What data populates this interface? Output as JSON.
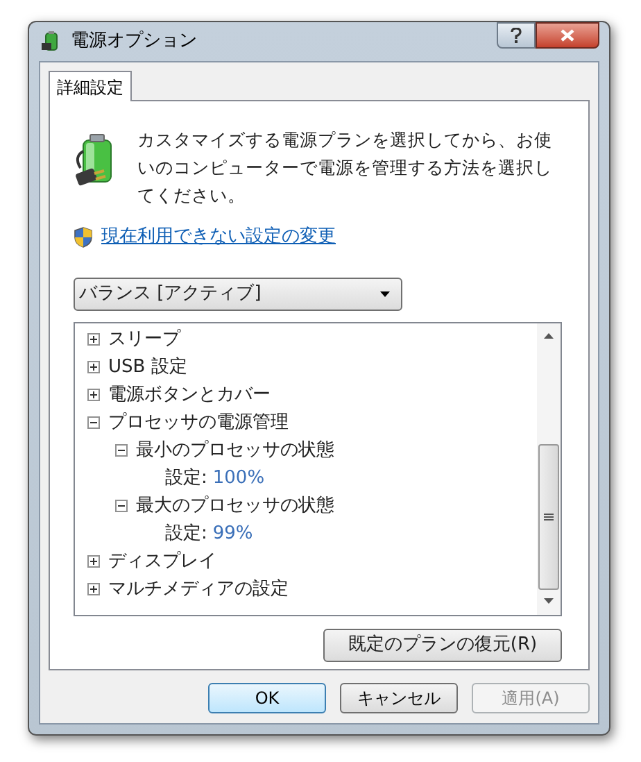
{
  "window": {
    "title": "電源オプション"
  },
  "tabs": [
    {
      "label": "詳細設定",
      "selected": true
    }
  ],
  "description": "カスタマイズする電源プランを選択してから、お使いのコンピューターで電源を管理する方法を選択してください。",
  "change_settings_link": "現在利用できない設定の変更",
  "plan_dropdown": {
    "value": "バランス [アクティブ]"
  },
  "tree": [
    {
      "kind": "group",
      "label": "スリープ",
      "expanded": false
    },
    {
      "kind": "group",
      "label": "USB 設定",
      "expanded": false
    },
    {
      "kind": "group",
      "label": "電源ボタンとカバー",
      "expanded": false
    },
    {
      "kind": "group",
      "label": "プロセッサの電源管理",
      "expanded": true,
      "children": [
        {
          "kind": "group",
          "label": "最小のプロセッサの状態",
          "expanded": true,
          "children": [
            {
              "kind": "setting",
              "label": "設定:",
              "value": "100%"
            }
          ]
        },
        {
          "kind": "group",
          "label": "最大のプロセッサの状態",
          "expanded": true,
          "children": [
            {
              "kind": "setting",
              "label": "設定:",
              "value": "99%"
            }
          ]
        }
      ]
    },
    {
      "kind": "group",
      "label": "ディスプレイ",
      "expanded": false
    },
    {
      "kind": "group",
      "label": "マルチメディアの設定",
      "expanded": false
    }
  ],
  "restore_button": "既定のプランの復元(R)",
  "buttons": [
    {
      "label": "OK",
      "disabled": false,
      "default": true
    },
    {
      "label": "キャンセル",
      "disabled": false,
      "default": false
    },
    {
      "label": "適用(A)",
      "disabled": true,
      "default": false
    }
  ]
}
